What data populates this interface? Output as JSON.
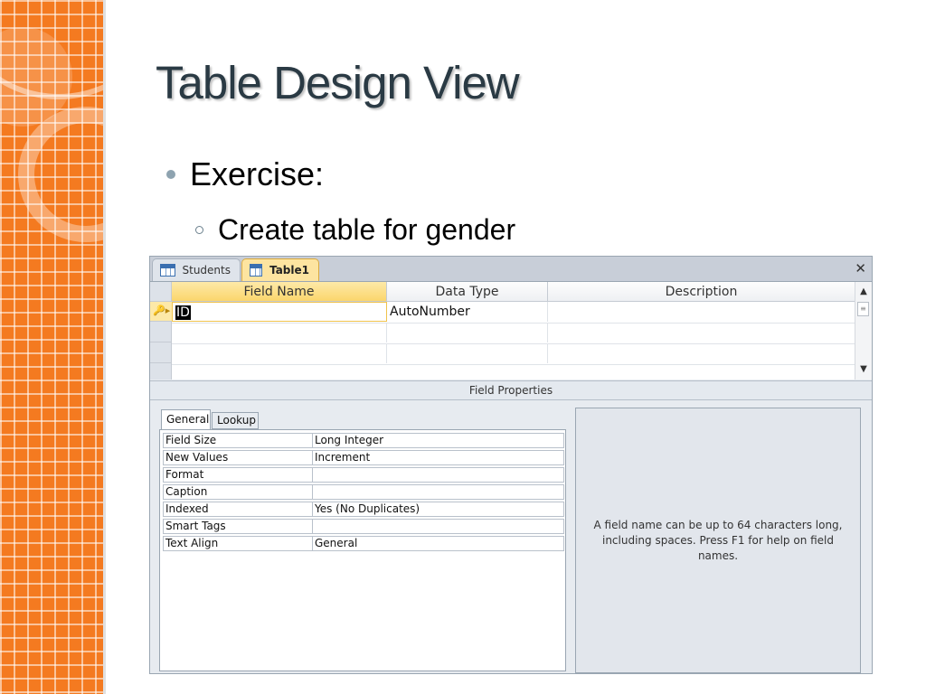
{
  "slide": {
    "title": "Table Design View",
    "bullet": "Exercise:",
    "sub_bullet": "Create table for gender"
  },
  "access": {
    "tabs": [
      {
        "label": "Students",
        "active": false
      },
      {
        "label": "Table1",
        "active": true
      }
    ],
    "close_icon": "close-icon",
    "columns": [
      "Field Name",
      "Data Type",
      "Description"
    ],
    "rows": [
      {
        "field_name": "ID",
        "data_type": "AutoNumber",
        "description": "",
        "primary_key": true
      },
      {
        "field_name": "",
        "data_type": "",
        "description": ""
      },
      {
        "field_name": "",
        "data_type": "",
        "description": ""
      }
    ],
    "field_properties_label": "Field Properties",
    "property_tabs": [
      "General",
      "Lookup"
    ],
    "properties": [
      {
        "label": "Field Size",
        "value": "Long Integer"
      },
      {
        "label": "New Values",
        "value": "Increment"
      },
      {
        "label": "Format",
        "value": ""
      },
      {
        "label": "Caption",
        "value": ""
      },
      {
        "label": "Indexed",
        "value": "Yes (No Duplicates)"
      },
      {
        "label": "Smart Tags",
        "value": ""
      },
      {
        "label": "Text Align",
        "value": "General"
      }
    ],
    "help_text": "A field name can be up to 64 characters long, including spaces. Press F1 for help on field names."
  },
  "colors": {
    "accent_orange": "#f47a20",
    "title_color": "#2a3a44",
    "active_tab": "#fde4a0",
    "selected_header": "#fbd66c"
  }
}
